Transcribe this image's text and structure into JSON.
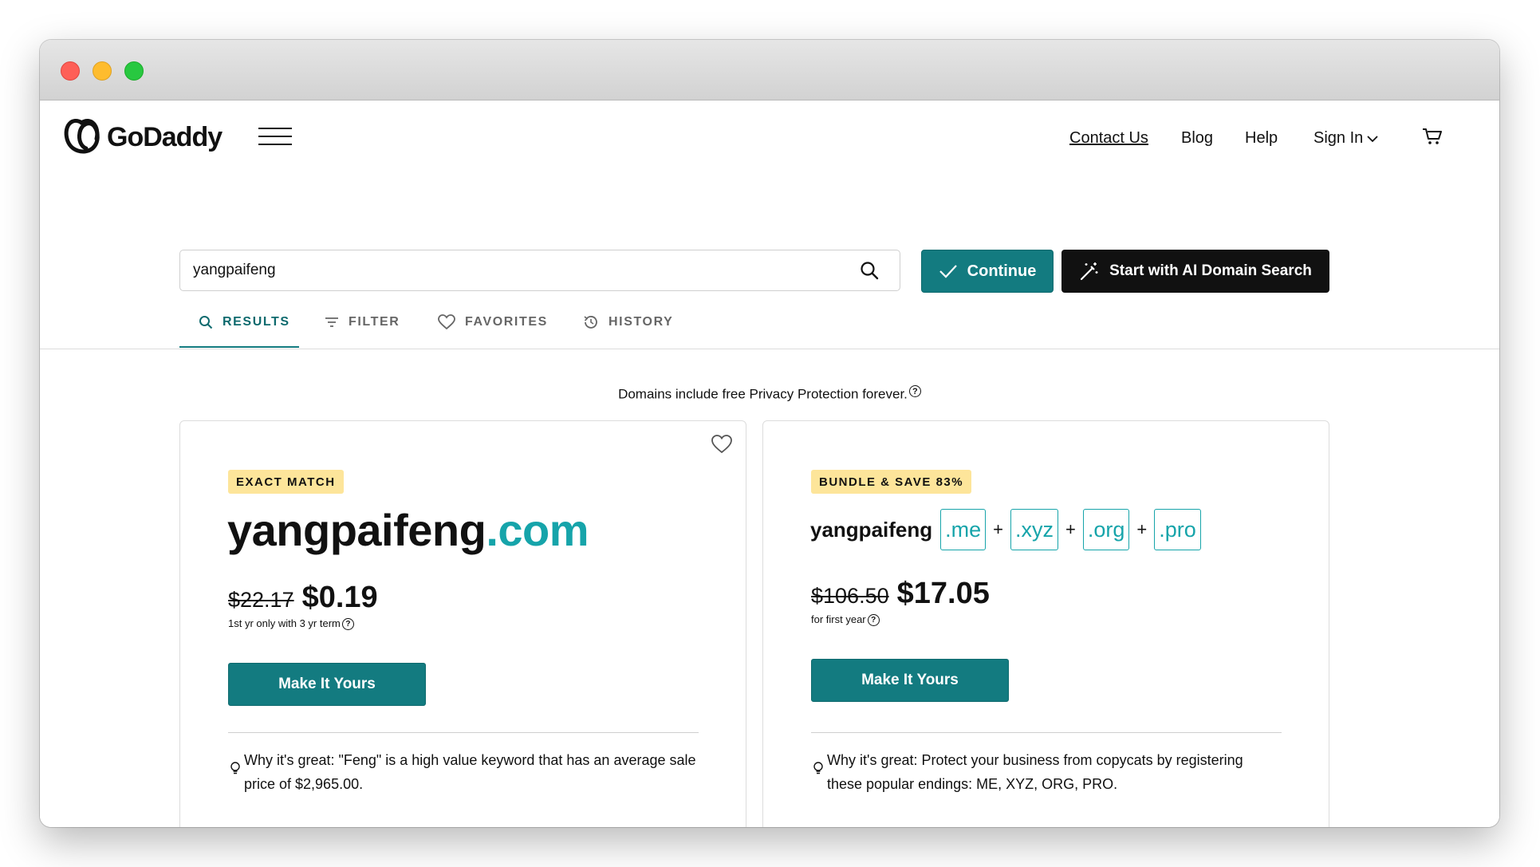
{
  "brand": {
    "name": "GoDaddy"
  },
  "nav": {
    "contact": "Contact Us",
    "blog": "Blog",
    "help": "Help",
    "sign_in": "Sign In"
  },
  "search": {
    "value": "yangpaifeng",
    "continue_label": "Continue",
    "ai_label": "Start with AI Domain Search"
  },
  "tabs": {
    "results": "RESULTS",
    "filter": "FILTER",
    "favorites": "FAVORITES",
    "history": "HISTORY"
  },
  "privacy_note": "Domains include free Privacy Protection forever.",
  "info_glyph": "?",
  "exact_match": {
    "badge": "EXACT MATCH",
    "domain_name": "yangpaifeng",
    "tld": ".com",
    "old_price": "$22.17",
    "new_price": "$0.19",
    "price_note": "1st yr only with 3 yr term",
    "button": "Make It Yours",
    "why": "Why it's great: \"Feng\" is a high value keyword that has an average sale price of $2,965.00."
  },
  "bundle": {
    "badge": "BUNDLE & SAVE 83%",
    "domain_name": "yangpaifeng",
    "tlds": [
      ".me",
      ".xyz",
      ".org",
      ".pro"
    ],
    "plus": "+",
    "old_price": "$106.50",
    "new_price": "$17.05",
    "price_note": "for first year",
    "button": "Make It Yours",
    "why": "Why it's great: Protect your business from copycats by registering these popular endings: ME, XYZ, ORG, PRO."
  },
  "colors": {
    "teal": "#137b80",
    "tld_accent": "#16a4aa",
    "badge_yellow": "#fde59a"
  }
}
